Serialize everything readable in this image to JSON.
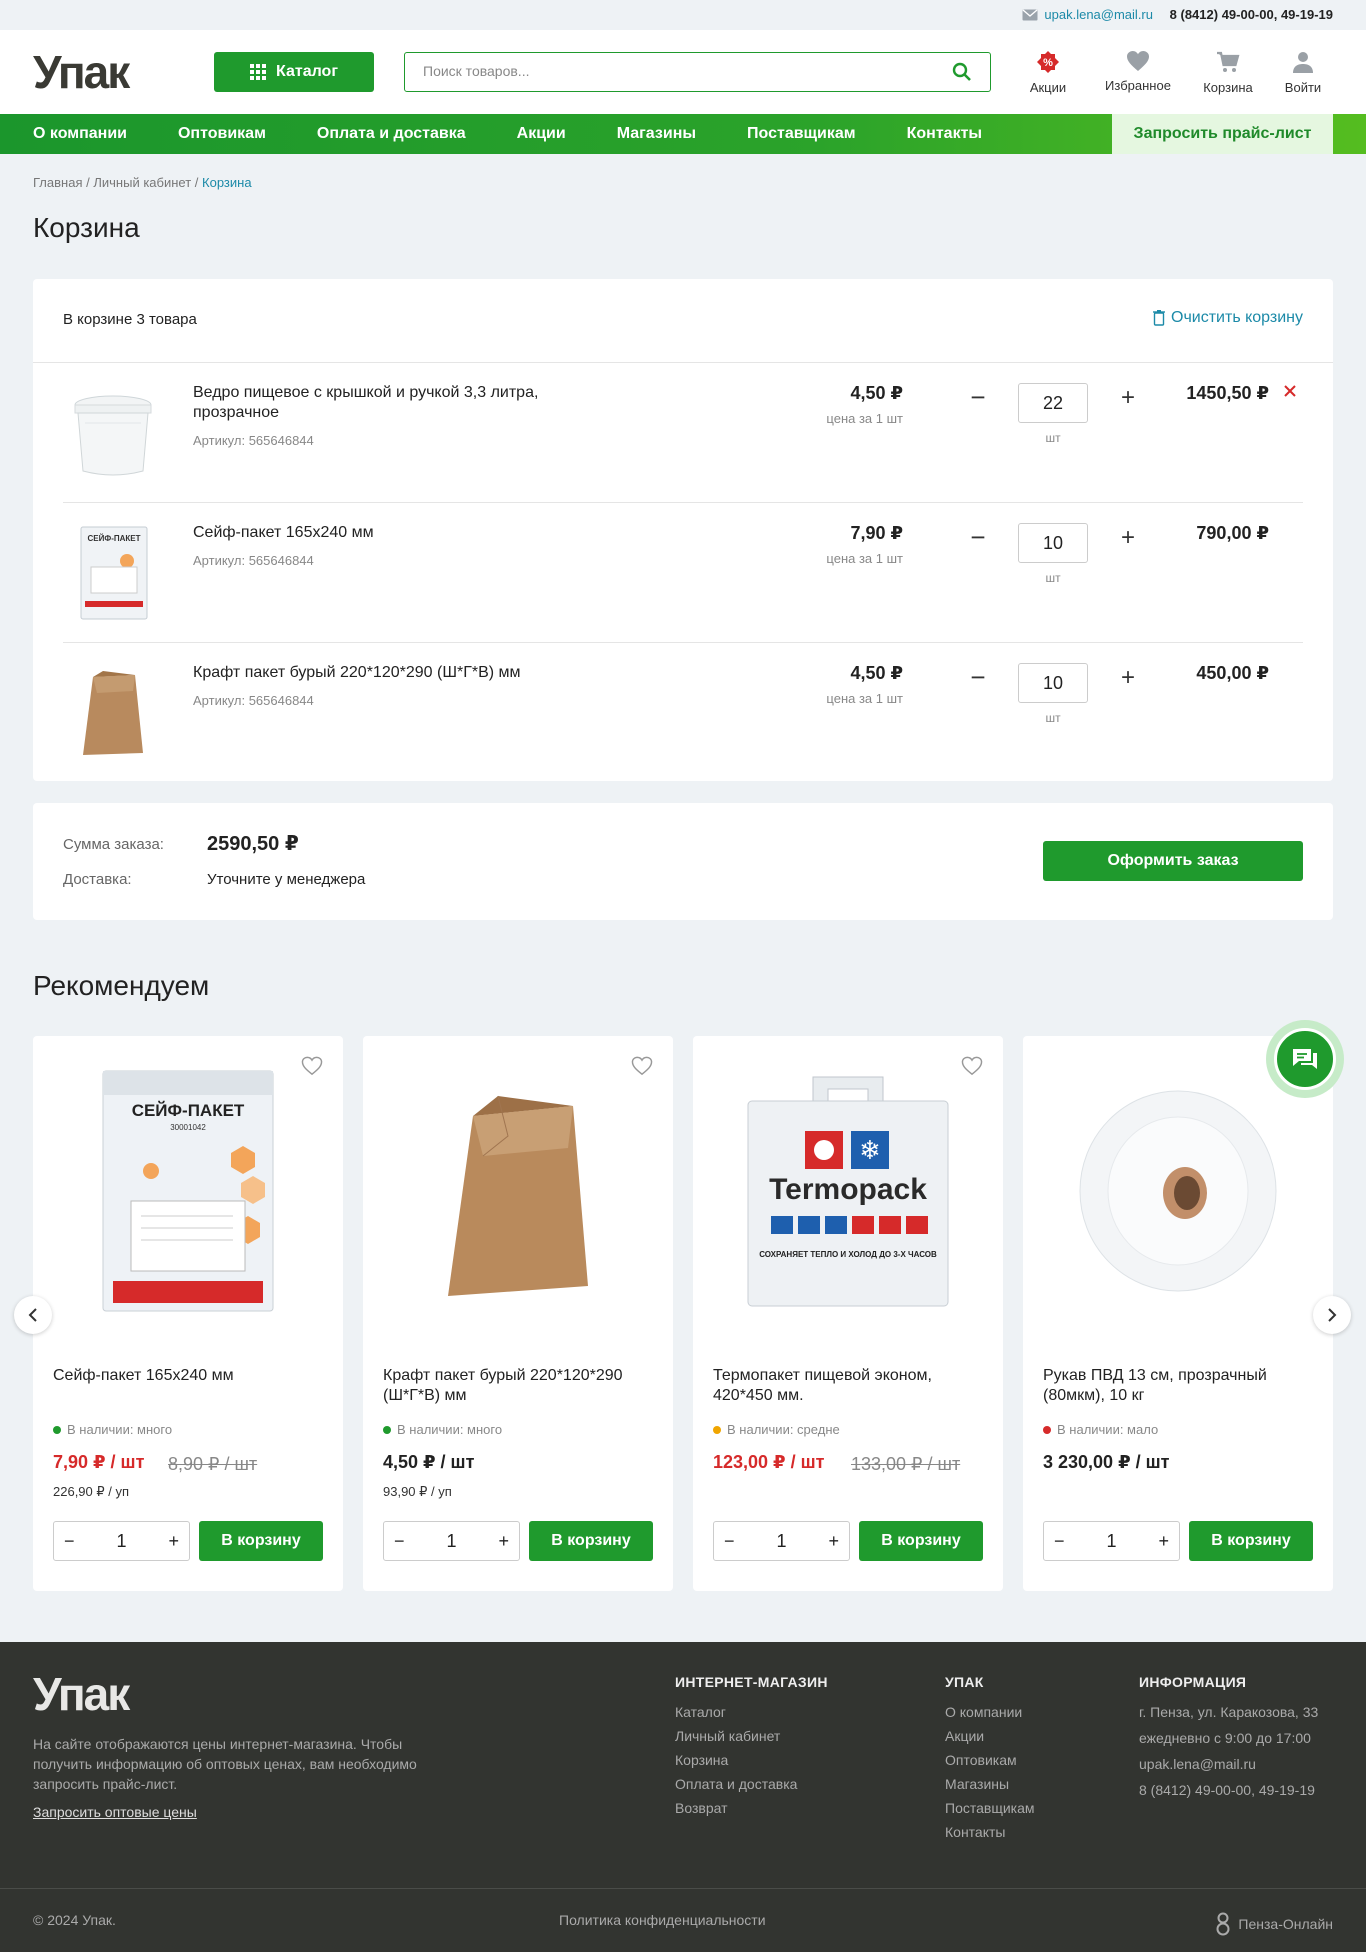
{
  "topbar": {
    "email": "upak.lena@mail.ru",
    "phone": "8 (8412) 49-00-00, 49-19-19"
  },
  "header": {
    "logo": "Упак",
    "catalog_label": "Каталог",
    "search_placeholder": "Поиск товаров...",
    "icons": [
      {
        "label": "Акции",
        "icon": "discount-icon"
      },
      {
        "label": "Избранное",
        "icon": "heart-icon"
      },
      {
        "label": "Корзина",
        "icon": "cart-icon"
      },
      {
        "label": "Войти",
        "icon": "user-icon"
      }
    ]
  },
  "nav": {
    "items": [
      "О компании",
      "Оптовикам",
      "Оплата и доставка",
      "Акции",
      "Магазины",
      "Поставщикам",
      "Контакты"
    ],
    "price_request": "Запросить прайс-лист"
  },
  "breadcrumb": {
    "items": [
      "Главная",
      "Личный кабинет"
    ],
    "current": "Корзина",
    "sep": "/"
  },
  "page_title": "Корзина",
  "cart": {
    "count_label": "В корзине 3 товара",
    "clear_label": "Очистить корзину",
    "items": [
      {
        "name": "Ведро пищевое с крышкой и ручкой 3,3 литра, прозрачное",
        "sku": "Артикул: 565646844",
        "price": "4,50 ₽",
        "unit": "цена за 1 шт",
        "qty": "22",
        "pcs": "шт",
        "total": "1450,50 ₽"
      },
      {
        "name": "Сейф-пакет 165х240 мм",
        "sku": "Артикул: 565646844",
        "price": "7,90 ₽",
        "unit": "цена за 1 шт",
        "qty": "10",
        "pcs": "шт",
        "total": "790,00 ₽"
      },
      {
        "name": "Крафт пакет бурый 220*120*290 (Ш*Г*В) мм",
        "sku": "Артикул: 565646844",
        "price": "4,50 ₽",
        "unit": "цена за 1 шт",
        "qty": "10",
        "pcs": "шт",
        "total": "450,00 ₽"
      }
    ]
  },
  "summary": {
    "sum_label": "Сумма заказа:",
    "sum_value": "2590,50 ₽",
    "delivery_label": "Доставка:",
    "delivery_value": "Уточните у менеджера",
    "order_button": "Оформить заказ"
  },
  "recommend": {
    "title": "Рекомендуем",
    "to_cart_label": "В корзину",
    "items": [
      {
        "name": "Сейф-пакет 165х240 мм",
        "stock": "В наличии: много",
        "stock_color": "#1f9a2d",
        "price": "7,90 ₽ / шт",
        "old_price": "8,90 ₽ / шт",
        "pack": "226,90 ₽ / уп",
        "qty": "1",
        "sale": true
      },
      {
        "name": "Крафт пакет бурый 220*120*290 (Ш*Г*В) мм",
        "stock": "В наличии: много",
        "stock_color": "#1f9a2d",
        "price": "4,50 ₽ / шт",
        "old_price": "",
        "pack": "93,90 ₽ / уп",
        "qty": "1",
        "sale": false
      },
      {
        "name": "Термопакет пищевой эконом, 420*450 мм.",
        "stock": "В наличии: средне",
        "stock_color": "#f0a500",
        "price": "123,00 ₽ / шт",
        "old_price": "133,00 ₽ / шт",
        "pack": "",
        "qty": "1",
        "sale": true
      },
      {
        "name": "Рукав ПВД 13 см, прозрачный (80мкм), 10 кг",
        "stock": "В наличии: мало",
        "stock_color": "#d62a2a",
        "price": "3 230,00 ₽ / шт",
        "old_price": "",
        "pack": "",
        "qty": "1",
        "sale": false
      }
    ],
    "images": {
      "safe_bag_title": "СЕЙФ-ПАКЕТ",
      "safe_bag_number": "30001042",
      "safe_bag_small_title": "СЕЙФ-ПАКЕТ",
      "thermo_brand": "Termopack",
      "thermo_slogan": "СОХРАНЯЕТ ТЕПЛО И ХОЛОД ДО 3-Х ЧАСОВ"
    }
  },
  "footer": {
    "logo": "Упак",
    "description": "На сайте отображаются цены интернет-магазина. Чтобы получить информацию об оптовых ценах, вам необходимо запросить прайс-лист.",
    "wholesale_link": "Запросить оптовые цены",
    "col1": {
      "title": "ИНТЕРНЕТ-МАГАЗИН",
      "items": [
        "Каталог",
        "Личный кабинет",
        "Корзина",
        "Оплата и доставка",
        "Возврат"
      ]
    },
    "col2": {
      "title": "УПАК",
      "items": [
        "О компании",
        "Акции",
        "Оптовикам",
        "Магазины",
        "Поставщикам",
        "Контакты"
      ]
    },
    "col3": {
      "title": "ИНФОРМАЦИЯ",
      "items": [
        "г. Пенза, ул. Каракозова, 33",
        "ежедневно с 9:00 до 17:00",
        "upak.lena@mail.ru",
        "8 (8412) 49-00-00, 49-19-19"
      ]
    },
    "copyright": "© 2024 Упак.",
    "privacy": "Политика конфиденциальности",
    "partner": "Пенза-Онлайн"
  },
  "colors": {
    "brand_green": "#1f9a2d",
    "link_blue": "#1c8aa8",
    "sale_red": "#d62a2a",
    "footer_bg": "#323430"
  }
}
